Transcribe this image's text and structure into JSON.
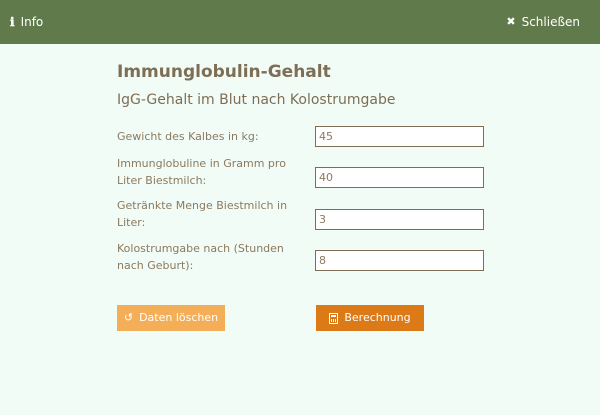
{
  "header": {
    "info_label": "Info",
    "close_label": "Schließen"
  },
  "main": {
    "title": "Immunglobulin-Gehalt",
    "subtitle": "IgG-Gehalt im Blut nach Kolostrumgabe"
  },
  "form": {
    "fields": [
      {
        "label": "Gewicht des Kalbes in kg:",
        "value": "45"
      },
      {
        "label": "Immunglobuline in Gramm pro Liter Biestmilch:",
        "value": "40"
      },
      {
        "label": "Getränkte Menge Biestmilch in Liter:",
        "value": "3"
      },
      {
        "label": "Kolostrumgabe nach (Stunden nach Geburt):",
        "value": "8"
      }
    ]
  },
  "actions": {
    "clear_label": "Daten löschen",
    "calc_label": "Berechnung"
  },
  "colors": {
    "header_bg": "#617a4c",
    "page_bg": "#f2fcf6",
    "clear_button_bg": "#f4ae57",
    "calc_button_bg": "#db7a16",
    "text": "#8a7a60"
  }
}
